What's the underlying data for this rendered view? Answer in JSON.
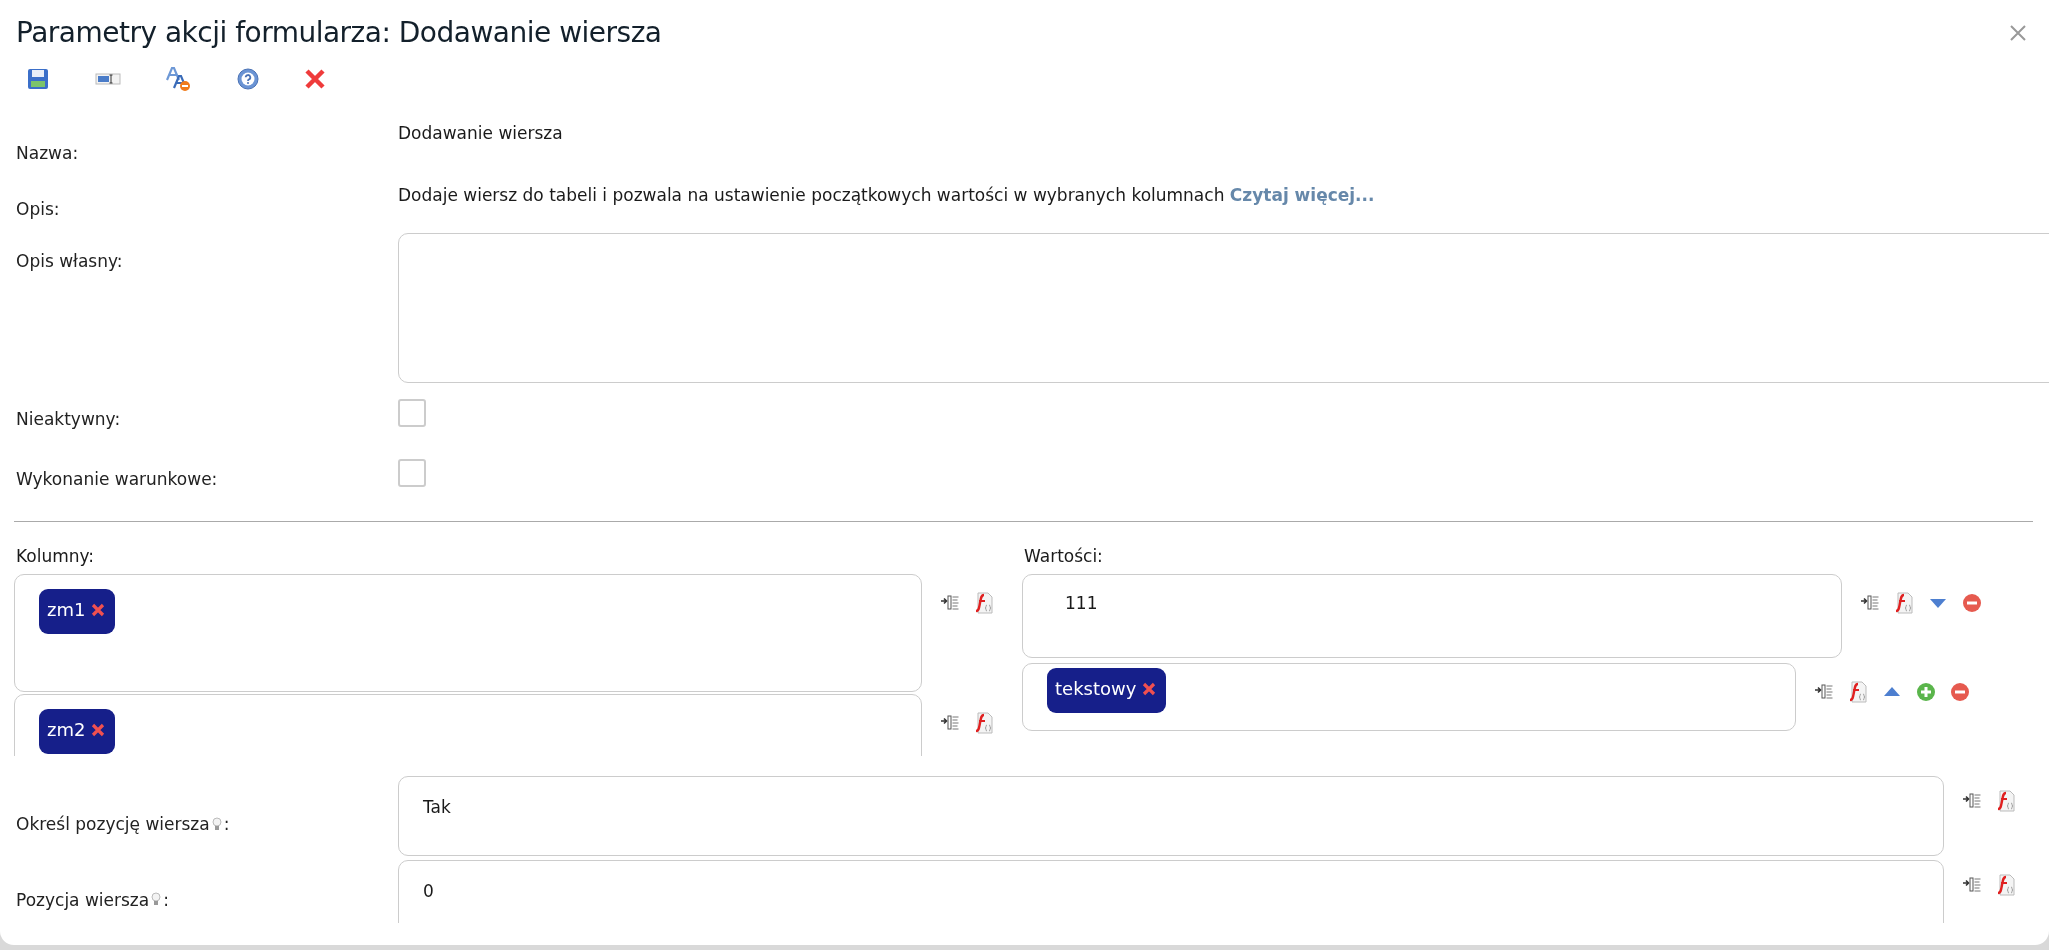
{
  "window": {
    "title": "Parametry akcji formularza: Dodawanie wiersza"
  },
  "fields": {
    "nazwa": {
      "label": "Nazwa:",
      "value": "Dodawanie wiersza"
    },
    "opis": {
      "label": "Opis:",
      "value": "Dodaje wiersz do tabeli i pozwala na ustawienie początkowych wartości w wybranych kolumnach",
      "link": "Czytaj więcej..."
    },
    "opis_wlasny": {
      "label": "Opis własny:"
    },
    "checkboxes": [
      {
        "label": "Nieaktywny:",
        "checked": false
      },
      {
        "label": "Wykonanie warunkowe:",
        "checked": false
      }
    ]
  },
  "kolumny": {
    "label": "Kolumny:",
    "items": [
      {
        "tags": [
          "zm1"
        ]
      },
      {
        "tags": [
          "zm2"
        ]
      }
    ]
  },
  "wartosci": {
    "label": "Wartości:",
    "items": [
      {
        "kind": "text",
        "value": "111",
        "move_down": true,
        "move_up": false,
        "add": false
      },
      {
        "kind": "tags",
        "tags": [
          "tekstowy"
        ],
        "move_down": false,
        "move_up": true,
        "add": true
      }
    ]
  },
  "bottom_fields": [
    {
      "label": "Określ pozycję wiersza",
      "label_end": ":",
      "value": "Tak"
    },
    {
      "label": "Pozycja wiersza",
      "label_end": ":",
      "value": "0"
    }
  ]
}
